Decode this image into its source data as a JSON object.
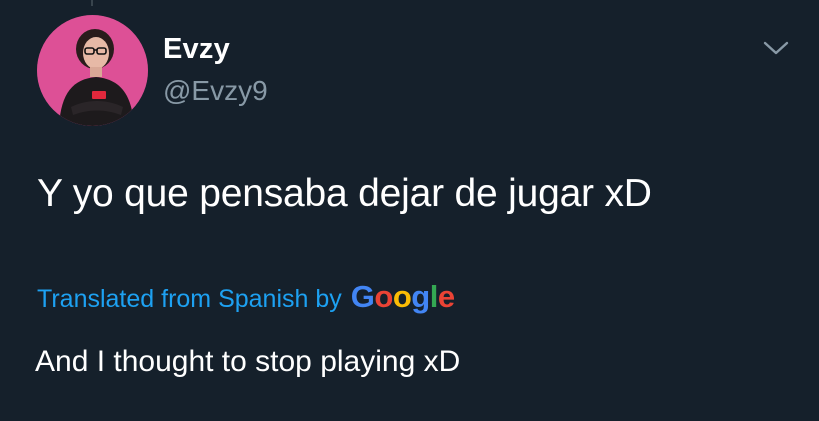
{
  "tweet": {
    "display_name": "Evzy",
    "handle": "@Evzy9",
    "text": "Y yo que pensaba dejar de jugar xD",
    "translated_label": "Translated from Spanish by",
    "translator_logo": {
      "letters": [
        "G",
        "o",
        "o",
        "g",
        "l",
        "e"
      ],
      "colors": [
        "#4285f4",
        "#ea4335",
        "#fbbc05",
        "#4285f4",
        "#34a853",
        "#ea4335"
      ]
    },
    "translation": "And I thought to stop playing xD"
  },
  "icons": {
    "menu": "chevron-down-icon"
  },
  "colors": {
    "background": "#15202b",
    "text_primary": "#ffffff",
    "text_secondary": "#8899a6",
    "link": "#1da1f2",
    "avatar_background": "#e0559a"
  }
}
